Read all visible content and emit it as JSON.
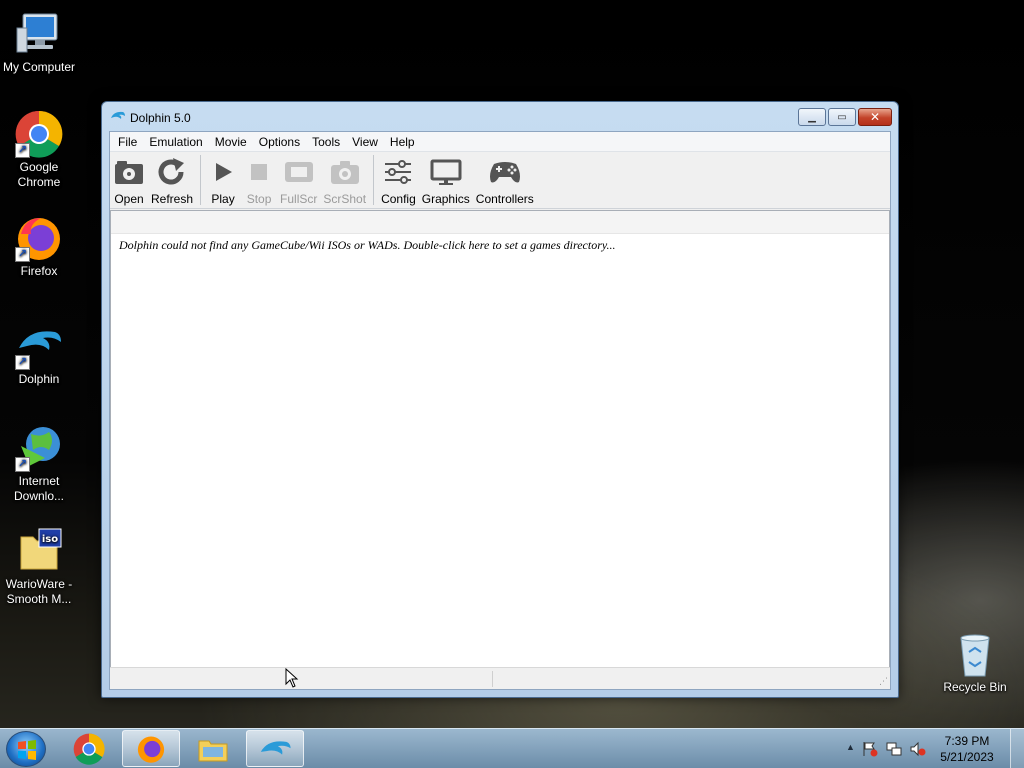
{
  "desktop": {
    "icons": [
      {
        "label": "My Computer",
        "icon": "computer-icon"
      },
      {
        "label": "Google Chrome",
        "icon": "chrome-icon"
      },
      {
        "label": "Firefox",
        "icon": "firefox-icon"
      },
      {
        "label": "Dolphin",
        "icon": "dolphin-icon"
      },
      {
        "label": "Internet Downlo...",
        "icon": "internet-download-manager-icon"
      },
      {
        "label": "WarioWare - Smooth M...",
        "icon": "iso-file-icon"
      },
      {
        "label": "Recycle Bin",
        "icon": "recycle-bin-icon"
      }
    ]
  },
  "window": {
    "title": "Dolphin 5.0",
    "menu": [
      "File",
      "Emulation",
      "Movie",
      "Options",
      "Tools",
      "View",
      "Help"
    ],
    "toolbar": [
      {
        "label": "Open",
        "icon": "open-icon",
        "enabled": true
      },
      {
        "label": "Refresh",
        "icon": "refresh-icon",
        "enabled": true
      },
      {
        "label": "Play",
        "icon": "play-icon",
        "enabled": true
      },
      {
        "label": "Stop",
        "icon": "stop-icon",
        "enabled": false
      },
      {
        "label": "FullScr",
        "icon": "fullscreen-icon",
        "enabled": false
      },
      {
        "label": "ScrShot",
        "icon": "camera-icon",
        "enabled": false
      },
      {
        "label": "Config",
        "icon": "config-icon",
        "enabled": true
      },
      {
        "label": "Graphics",
        "icon": "monitor-icon",
        "enabled": true
      },
      {
        "label": "Controllers",
        "icon": "gamepad-icon",
        "enabled": true
      }
    ],
    "gamelist_message": "Dolphin could not find any GameCube/Wii ISOs or WADs. Double-click here to set a games directory..."
  },
  "taskbar": {
    "apps": [
      "chrome-icon",
      "firefox-icon",
      "explorer-icon",
      "dolphin-icon"
    ],
    "clock": {
      "time": "7:39 PM",
      "date": "5/21/2023"
    }
  },
  "colors": {
    "accent": "#1f6fc4",
    "titlebar": "#c6dcf1"
  }
}
